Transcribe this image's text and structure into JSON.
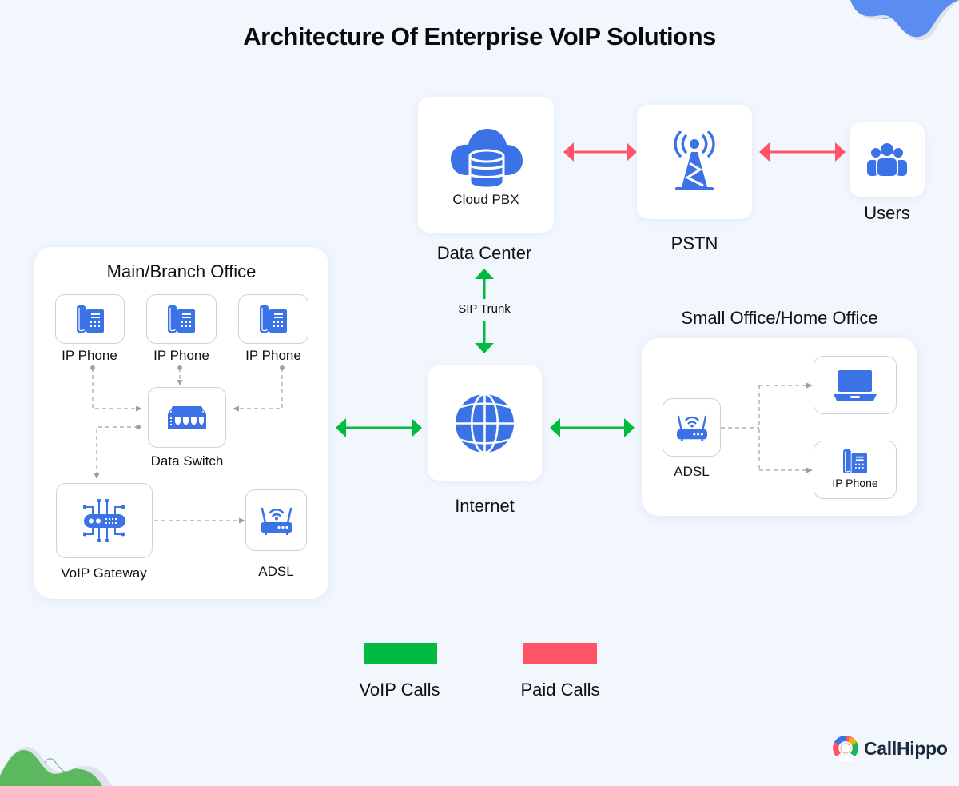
{
  "title": "Architecture Of Enterprise VoIP Solutions",
  "colors": {
    "background": "#f2f7fe",
    "icon_blue": "#3b73e6",
    "voip_green": "#00bb40",
    "paid_red": "#ff5567",
    "dashed_gray": "#9a9a9a",
    "wave_blue": "#5b8cf0",
    "wave_green": "#5cb85f"
  },
  "top_row": {
    "data_center": {
      "inner_label": "Cloud PBX",
      "caption": "Data Center",
      "icon": "cloud-database-icon"
    },
    "pstn": {
      "caption": "PSTN",
      "icon": "cell-tower-icon"
    },
    "users": {
      "caption": "Users",
      "icon": "users-group-icon"
    }
  },
  "sip_trunk": {
    "label": "SIP Trunk"
  },
  "internet": {
    "caption": "Internet",
    "icon": "globe-icon"
  },
  "main_office": {
    "title": "Main/Branch Office",
    "phones": [
      {
        "label": "IP Phone",
        "icon": "desk-phone-icon"
      },
      {
        "label": "IP Phone",
        "icon": "desk-phone-icon"
      },
      {
        "label": "IP Phone",
        "icon": "desk-phone-icon"
      }
    ],
    "data_switch": {
      "label": "Data Switch",
      "icon": "network-switch-icon"
    },
    "voip_gateway": {
      "label": "VoIP Gateway",
      "icon": "gateway-circuit-icon"
    },
    "adsl": {
      "label": "ADSL",
      "icon": "wifi-router-icon"
    }
  },
  "small_office": {
    "title": "Small Office/Home Office",
    "adsl": {
      "label": "ADSL",
      "icon": "wifi-router-icon"
    },
    "laptop": {
      "icon": "laptop-icon"
    },
    "ip_phone": {
      "label": "IP Phone",
      "icon": "desk-phone-icon"
    }
  },
  "legend": [
    {
      "label": "VoIP Calls",
      "color": "#00bb40"
    },
    {
      "label": "Paid Calls",
      "color": "#ff5567"
    }
  ],
  "brand": {
    "name": "CallHippo"
  }
}
